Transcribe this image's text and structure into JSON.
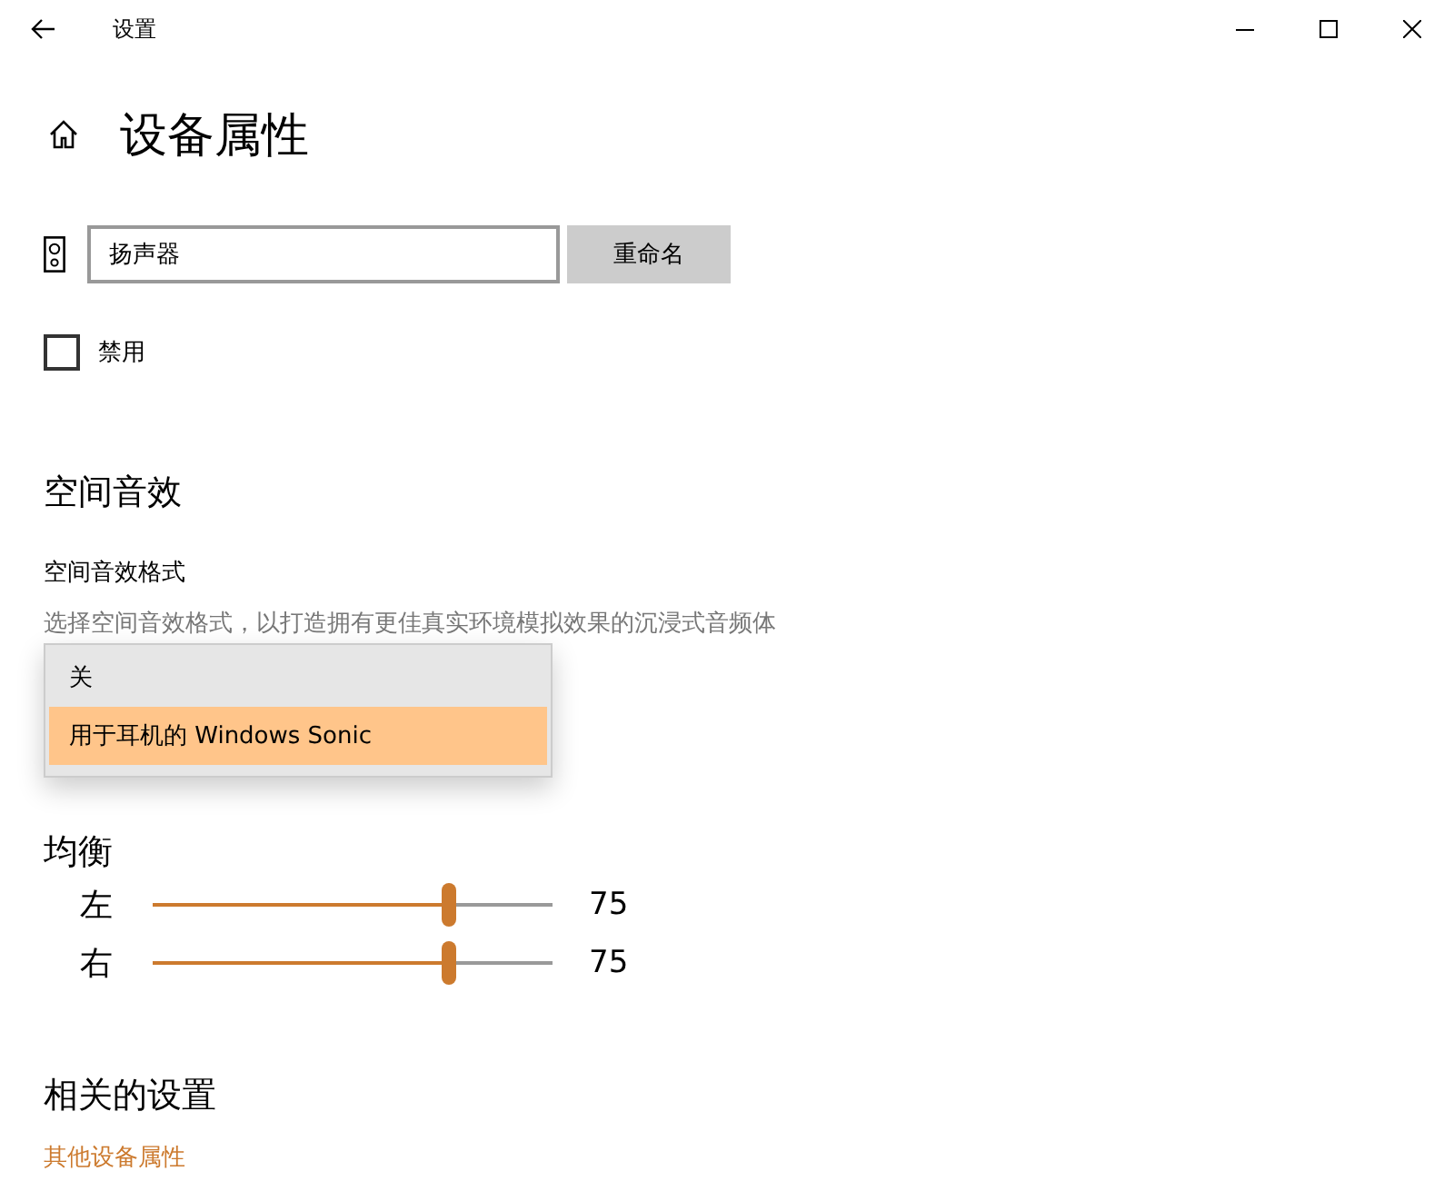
{
  "window": {
    "title": "设置"
  },
  "page": {
    "title": "设备属性"
  },
  "device": {
    "name_value": "扬声器",
    "rename_button": "重命名"
  },
  "disable": {
    "label": "禁用",
    "checked": false
  },
  "spatial": {
    "heading": "空间音效",
    "format_label": "空间音效格式",
    "description": "选择空间音效格式，以打造拥有更佳真实环境模拟效果的沉浸式音频体",
    "options": [
      {
        "label": "关",
        "selected": false
      },
      {
        "label": "用于耳机的 Windows Sonic",
        "selected": true
      }
    ]
  },
  "balance": {
    "heading": "均衡",
    "channels": [
      {
        "name": "左",
        "level": 0.74,
        "reading": "75"
      },
      {
        "name": "右",
        "level": 0.74,
        "reading": "75"
      }
    ]
  },
  "related": {
    "heading": "相关的设置",
    "links": [
      "其他设备属性"
    ]
  }
}
